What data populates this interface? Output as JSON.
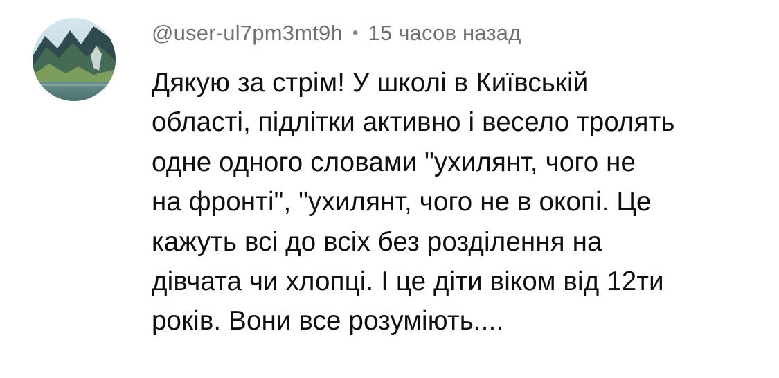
{
  "comment": {
    "author": "@user-ul7pm3mt9h",
    "separator": "•",
    "time": "15 часов назад",
    "avatar_icon": "mountain-lake-avatar",
    "text_lines": [
      "Дякую за стрім! У школі в Київській",
      "області, підлітки активно і весело тролять",
      "одне одного словами \"ухилянт, чого не",
      "на фронті\", \"ухилянт, чого не в окопі. Це",
      "кажуть всі до всіх без розділення на",
      "дівчата чи хлопці. І це діти віком від 12ти",
      "років. Вони все розуміють...."
    ]
  },
  "colors": {
    "background": "#ffffff",
    "author_text": "#6f6f6f",
    "comment_text": "#0f0f0f"
  }
}
